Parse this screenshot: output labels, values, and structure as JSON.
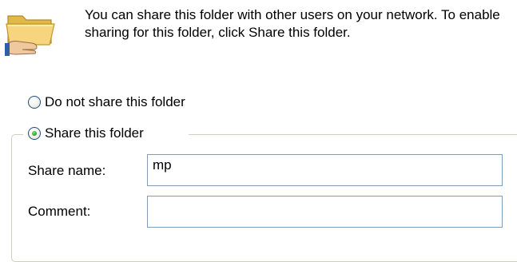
{
  "description": "You can share this folder with other users on your network.  To enable sharing for this folder, click Share this folder.",
  "sharing": {
    "no_share_label": "Do not share this folder",
    "share_label": "Share this folder",
    "selected": "share"
  },
  "fields": {
    "share_name_label": "Share name:",
    "share_name_value": "mp",
    "comment_label": "Comment:",
    "comment_value": ""
  },
  "icons": {
    "header": "shared-folder-icon"
  },
  "colors": {
    "radio_border": "#1c5180",
    "radio_dot": "#2a9a27",
    "input_border": "#7f9db9",
    "groupbox_border": "#d0d0bf"
  }
}
